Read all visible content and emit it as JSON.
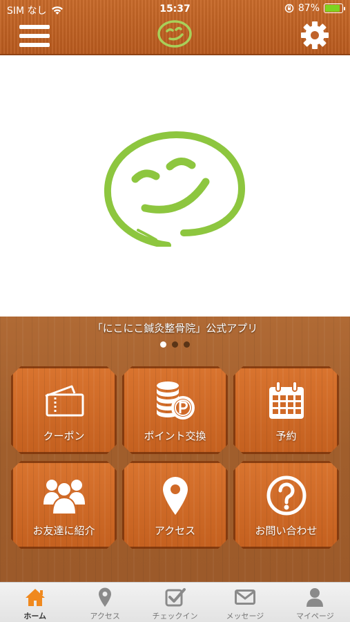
{
  "status_bar": {
    "carrier": "SIM なし",
    "time": "15:37",
    "battery": "87%",
    "battery_level": 0.87,
    "icons": [
      "wifi-icon",
      "orientation-lock-icon",
      "battery-charging-icon"
    ]
  },
  "nav": {
    "menu_icon": "hamburger-menu-icon",
    "logo": "smile-logo",
    "settings_icon": "gear-icon"
  },
  "panel": {
    "app_title": "「にこにこ鍼灸整骨院」公式アプリ",
    "page_indicator": {
      "count": 3,
      "active": 0
    }
  },
  "tiles": [
    {
      "label": "クーポン",
      "icon": "ticket-icon"
    },
    {
      "label": "ポイント交換",
      "icon": "coins-point-icon"
    },
    {
      "label": "予約",
      "icon": "calendar-icon"
    },
    {
      "label": "お友達に紹介",
      "icon": "people-icon"
    },
    {
      "label": "アクセス",
      "icon": "map-pin-icon"
    },
    {
      "label": "お問い合わせ",
      "icon": "question-icon"
    }
  ],
  "tabbar": [
    {
      "label": "ホーム",
      "icon": "home-icon",
      "active": true
    },
    {
      "label": "アクセス",
      "icon": "map-pin-icon",
      "active": false
    },
    {
      "label": "チェックイン",
      "icon": "checkin-icon",
      "active": false
    },
    {
      "label": "メッセージ",
      "icon": "envelope-icon",
      "active": false
    },
    {
      "label": "マイページ",
      "icon": "user-icon",
      "active": false
    }
  ],
  "colors": {
    "header": "#c0632a",
    "tile": "#d06a28",
    "logo_green": "#8dc63f",
    "tab_active": "#f0891e"
  }
}
